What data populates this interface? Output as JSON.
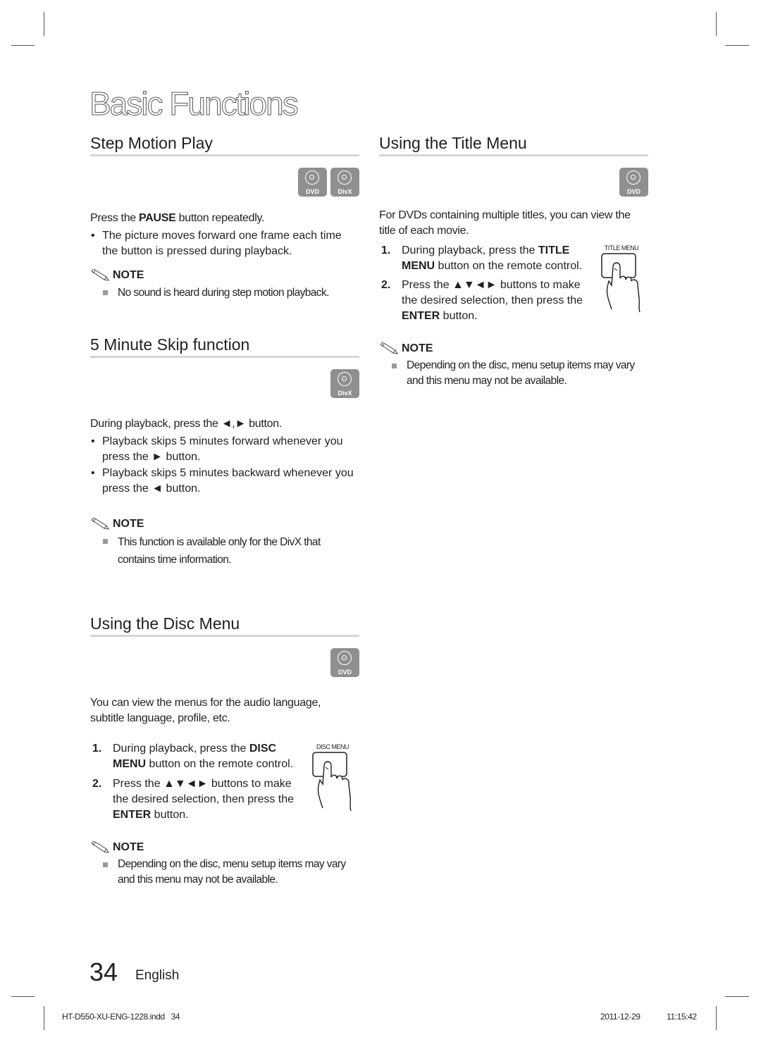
{
  "page_title": "Basic Functions",
  "sections": {
    "step_motion": {
      "heading": "Step Motion Play",
      "badges": [
        "DVD",
        "DivX"
      ],
      "intro_pre": "Press the ",
      "intro_bold": "PAUSE",
      "intro_post": " button repeatedly.",
      "bullets": [
        "The picture moves forward one frame each time the button is pressed during playback."
      ],
      "note_label": "NOTE",
      "notes": [
        "No sound is heard during step motion playback."
      ]
    },
    "five_minute_skip": {
      "heading": "5 Minute Skip function",
      "badges": [
        "DivX"
      ],
      "intro": "During playback, press the ◄,► button.",
      "bullets": [
        "Playback skips 5 minutes forward whenever you press the ► button.",
        "Playback skips 5 minutes backward whenever you press the ◄ button."
      ],
      "note_label": "NOTE",
      "notes": [
        "This function is available only for the DivX that contains time information."
      ]
    },
    "disc_menu": {
      "heading": "Using the Disc Menu",
      "badges": [
        "DVD"
      ],
      "intro": "You can view the menus for the audio language, subtitle language, profile, etc.",
      "remote_label": "DISC MENU",
      "steps": [
        {
          "num": "1.",
          "pre": "During playback, press the ",
          "bold": "DISC MENU",
          "post": " button on the remote control."
        },
        {
          "num": "2.",
          "pre": "Press the ▲▼◄► buttons to make the desired selection, then press the ",
          "bold": "ENTER",
          "post": " button."
        }
      ],
      "note_label": "NOTE",
      "notes": [
        "Depending on the disc, menu setup items may vary and this menu may not be available."
      ]
    },
    "title_menu": {
      "heading": "Using the Title Menu",
      "badges": [
        "DVD"
      ],
      "intro": "For DVDs containing multiple titles, you can view the title of each movie.",
      "remote_label": "TITLE MENU",
      "steps": [
        {
          "num": "1.",
          "pre": " During playback, press the ",
          "bold": "TITLE MENU",
          "post": " button on the remote control."
        },
        {
          "num": "2.",
          "pre": "Press the ▲▼◄► buttons to make the desired selection, then press the ",
          "bold": "ENTER",
          "post": " button."
        }
      ],
      "note_label": "NOTE",
      "notes": [
        "Depending on the disc, menu setup items may vary and this menu may not be available."
      ]
    }
  },
  "footer": {
    "page_number": "34",
    "language": "English",
    "slug_file": "HT-D550-XU-ENG-1228.indd   34",
    "slug_date": "2011-12-29",
    "slug_time": "11:15:42"
  }
}
